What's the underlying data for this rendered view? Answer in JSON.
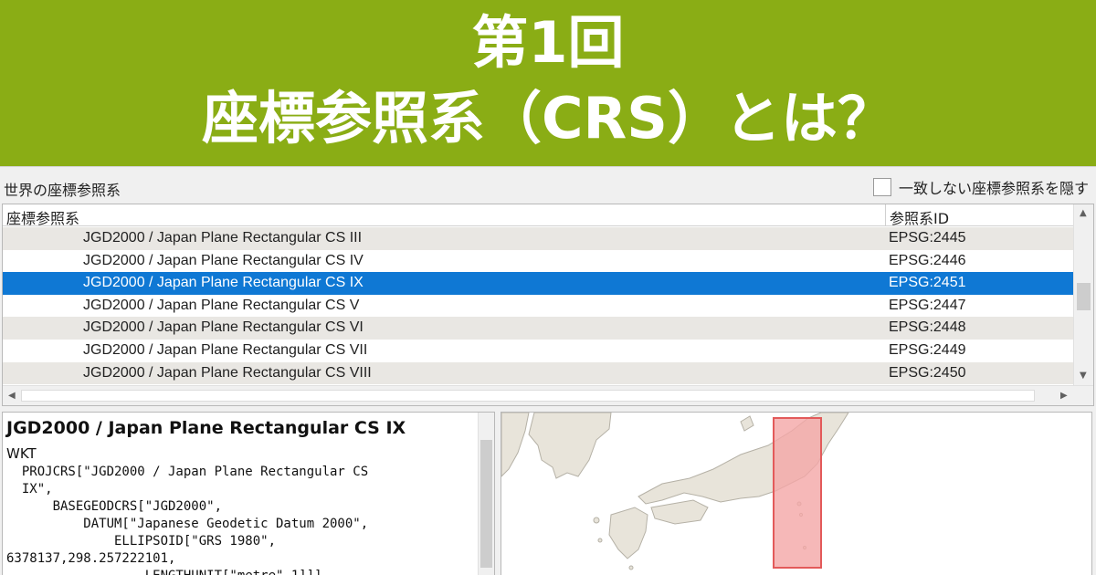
{
  "banner": {
    "line1": "第1回",
    "line2": "座標参照系（CRS）とは？"
  },
  "dialog": {
    "section_title": "世界の座標参照系",
    "hide_checkbox_label": "一致しない座標参照系を隠す",
    "hide_checkbox_checked": false,
    "table": {
      "headers": {
        "crs": "座標参照系",
        "id": "参照系ID"
      },
      "rows": [
        {
          "name": "JGD2000 / Japan Plane Rectangular CS III",
          "id": "EPSG:2445",
          "selected": false
        },
        {
          "name": "JGD2000 / Japan Plane Rectangular CS IV",
          "id": "EPSG:2446",
          "selected": false
        },
        {
          "name": "JGD2000 / Japan Plane Rectangular CS IX",
          "id": "EPSG:2451",
          "selected": true
        },
        {
          "name": "JGD2000 / Japan Plane Rectangular CS V",
          "id": "EPSG:2447",
          "selected": false
        },
        {
          "name": "JGD2000 / Japan Plane Rectangular CS VI",
          "id": "EPSG:2448",
          "selected": false
        },
        {
          "name": "JGD2000 / Japan Plane Rectangular CS VII",
          "id": "EPSG:2449",
          "selected": false
        },
        {
          "name": "JGD2000 / Japan Plane Rectangular CS VIII",
          "id": "EPSG:2450",
          "selected": false
        }
      ]
    },
    "wkt": {
      "title": "JGD2000 / Japan Plane Rectangular CS IX",
      "label": "WKT",
      "text": "  PROJCRS[\"JGD2000 / Japan Plane Rectangular CS\n  IX\",\n      BASEGEODCRS[\"JGD2000\",\n          DATUM[\"Japanese Geodetic Datum 2000\",\n              ELLIPSOID[\"GRS 1980\",\n6378137,298.257222101,\n                  LENGTHUNIT[\"metre\",1]]]"
    },
    "map": {
      "land_color": "#e8e4da",
      "land_stroke": "#b5b1a6",
      "extent_fill": "#f4a6a6",
      "extent_stroke": "#e35a5a"
    }
  }
}
